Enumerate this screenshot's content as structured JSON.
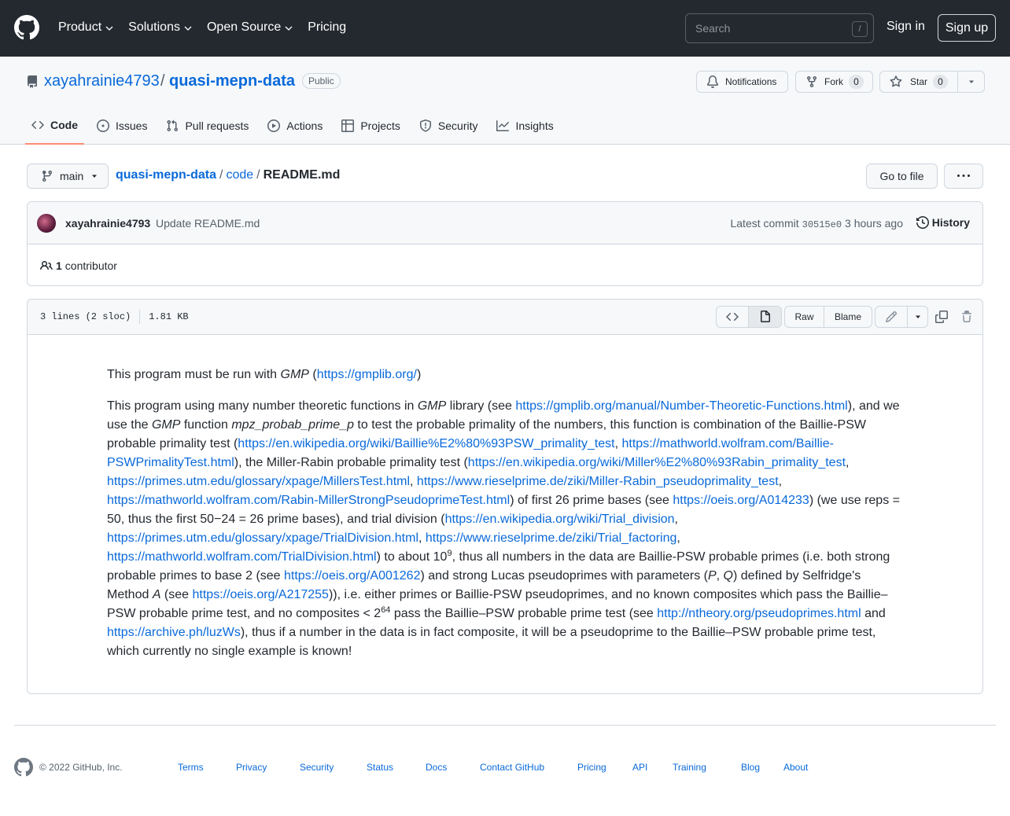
{
  "header": {
    "nav": [
      {
        "label": "Product",
        "dropdown": true
      },
      {
        "label": "Solutions",
        "dropdown": true
      },
      {
        "label": "Open Source",
        "dropdown": true
      },
      {
        "label": "Pricing",
        "dropdown": false
      }
    ],
    "search_placeholder": "Search",
    "search_shortcut": "/",
    "sign_in": "Sign in",
    "sign_up": "Sign up"
  },
  "repo": {
    "owner": "xayahrainie4793",
    "separator": "/",
    "name": "quasi-mepn-data",
    "visibility": "Public",
    "notifications_label": "Notifications",
    "fork_label": "Fork",
    "fork_count": "0",
    "star_label": "Star",
    "star_count": "0"
  },
  "tabs": [
    {
      "label": "Code",
      "icon": "code-icon",
      "selected": true
    },
    {
      "label": "Issues",
      "icon": "issue-icon",
      "selected": false
    },
    {
      "label": "Pull requests",
      "icon": "pull-request-icon",
      "selected": false
    },
    {
      "label": "Actions",
      "icon": "play-icon",
      "selected": false
    },
    {
      "label": "Projects",
      "icon": "table-icon",
      "selected": false
    },
    {
      "label": "Security",
      "icon": "shield-icon",
      "selected": false
    },
    {
      "label": "Insights",
      "icon": "graph-icon",
      "selected": false
    }
  ],
  "file_nav": {
    "branch": "main",
    "path": [
      "quasi-mepn-data",
      "code"
    ],
    "file": "README.md",
    "go_to_file": "Go to file"
  },
  "commit": {
    "author": "xayahrainie4793",
    "message": "Update README.md",
    "latest_label": "Latest commit",
    "sha": "30515e0",
    "time": "3 hours ago",
    "history": "History",
    "contributors_count": "1",
    "contributors_label": "contributor"
  },
  "file": {
    "lines": "3 lines (2 sloc)",
    "size": "1.81 KB",
    "raw": "Raw",
    "blame": "Blame"
  },
  "readme": {
    "p1": {
      "a": "This program must be run with ",
      "gmp": "GMP",
      "b": " (",
      "link": "https://gmplib.org/",
      "c": ")"
    },
    "p2": {
      "t1": "This program using many number theoretic functions in ",
      "gmp1": "GMP",
      "t2": " library (see ",
      "l1": "https://gmplib.org/manual/Number-Theoretic-Functions.html",
      "t3": "), and we use the ",
      "gmp2": "GMP",
      "t4": " function ",
      "fn": "mpz_probab_prime_p",
      "t5": " to test the probable primality of the numbers, this function is combination of the Baillie-PSW probable primality test (",
      "l2": "https://en.wikipedia.org/wiki/Baillie%E2%80%93PSW_primality_test",
      "t6": ", ",
      "l3": "https://mathworld.wolfram.com/Baillie-PSWPrimalityTest.html",
      "t7": "), the Miller-Rabin probable primality test (",
      "l4": "https://en.wikipedia.org/wiki/Miller%E2%80%93Rabin_primality_test",
      "t8": ", ",
      "l5": "https://primes.utm.edu/glossary/xpage/MillersTest.html",
      "t9": ", ",
      "l6": "https://www.rieselprime.de/ziki/Miller-Rabin_pseudoprimality_test",
      "t10": ", ",
      "l7": "https://mathworld.wolfram.com/Rabin-MillerStrongPseudoprimeTest.html",
      "t11": ") of first 26 prime bases (see ",
      "l8": "https://oeis.org/A014233",
      "t12": ") (we use reps = 50, thus the first 50−24 = 26 prime bases), and trial division (",
      "l9": "https://en.wikipedia.org/wiki/Trial_division",
      "t13": ", ",
      "l10": "https://primes.utm.edu/glossary/xpage/TrialDivision.html",
      "t14": ", ",
      "l11": "https://www.rieselprime.de/ziki/Trial_factoring",
      "t15": ", ",
      "l12": "https://mathworld.wolfram.com/TrialDivision.html",
      "t16": ") to about 10",
      "sup1": "9",
      "t17": ", thus all numbers in the data are Baillie-PSW probable primes (i.e. both strong probable primes to base 2 (see ",
      "l13": "https://oeis.org/A001262",
      "t18": ") and strong Lucas pseudoprimes with parameters (",
      "P": "P",
      "t19": ", ",
      "Q": "Q",
      "t20": ") defined by Selfridge's Method ",
      "A": "A",
      "t21": " (see ",
      "l14": "https://oeis.org/A217255",
      "t22": ")), i.e. either primes or Baillie-PSW pseudoprimes, and no known composites which pass the Baillie–PSW probable prime test, and no composites < 2",
      "sup2": "64",
      "t23": " pass the Baillie–PSW probable prime test (see ",
      "l15": "http://ntheory.org/pseudoprimes.html",
      "t24": " and ",
      "l16": "https://archive.ph/luzWs",
      "t25": "), thus if a number in the data is in fact composite, it will be a pseudoprime to the Baillie–PSW probable prime test, which currently no single example is known!"
    }
  },
  "footer": {
    "copyright": "© 2022 GitHub, Inc.",
    "links": [
      "Terms",
      "Privacy",
      "Security",
      "Status",
      "Docs",
      "Contact GitHub",
      "Pricing",
      "API",
      "Training",
      "Blog",
      "About"
    ]
  },
  "colors": {
    "header_bg": "#24292f",
    "link": "#0969da",
    "tab_underline": "#fd8c73",
    "border": "#d0d7de"
  }
}
